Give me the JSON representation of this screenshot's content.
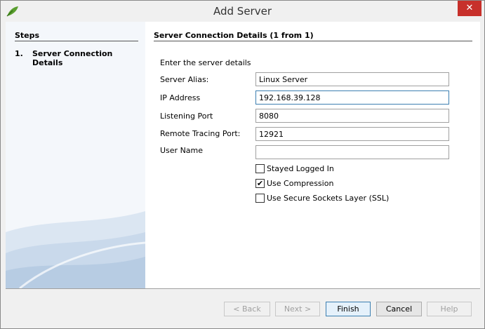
{
  "window": {
    "title": "Add Server",
    "close_label": "✕"
  },
  "steps": {
    "title": "Steps",
    "items": [
      {
        "number": "1.",
        "label": "Server Connection Details"
      }
    ]
  },
  "main": {
    "title": "Server Connection Details (1 from 1)",
    "intro": "Enter the server details",
    "fields": {
      "server_alias": {
        "label": "Server Alias:",
        "value": "Linux Server"
      },
      "ip_address": {
        "label": "IP Address",
        "value": "192.168.39.128"
      },
      "listening_port": {
        "label": "Listening Port",
        "value": "8080"
      },
      "remote_tracing_port": {
        "label": "Remote Tracing Port:",
        "value": "12921"
      },
      "user_name": {
        "label": "User Name",
        "value": ""
      }
    },
    "checkboxes": {
      "stayed_logged_in": {
        "label": "Stayed Logged In",
        "checked": false,
        "mark": ""
      },
      "use_compression": {
        "label": "Use Compression",
        "checked": true,
        "mark": "✔"
      },
      "use_ssl": {
        "label": "Use Secure Sockets Layer (SSL)",
        "checked": false,
        "mark": ""
      }
    }
  },
  "buttons": {
    "back": "< Back",
    "next": "Next >",
    "finish": "Finish",
    "cancel": "Cancel",
    "help": "Help"
  },
  "colors": {
    "accent": "#3c7fb1",
    "close": "#c7302b"
  }
}
